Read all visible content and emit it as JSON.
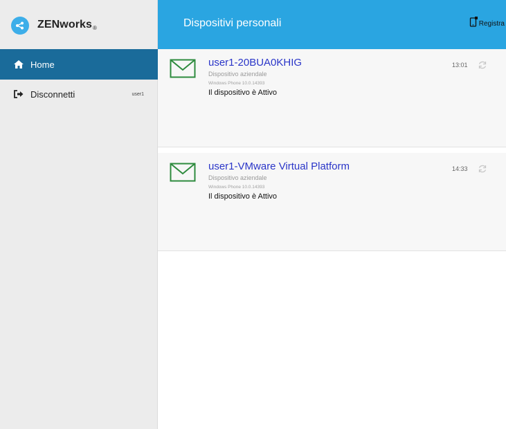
{
  "brand": {
    "name": "ZENworks",
    "trademark": "®",
    "logo_icon": "zenworks-logo-icon",
    "logo_color": "#3daee9"
  },
  "sidebar": {
    "items": [
      {
        "label": "Home",
        "icon": "home-icon",
        "active": true
      },
      {
        "label": "Disconnetti",
        "icon": "sign-out-icon",
        "user": "user1"
      }
    ],
    "active_color": "#1a6b9a"
  },
  "header": {
    "title": "Dispositivi personali",
    "register_label": "Registra",
    "register_icon": "device-register-icon",
    "color": "#2aa5e1"
  },
  "devices": [
    {
      "name": "user1-20BUA0KHIG",
      "type": "Dispositivo aziendale",
      "os": "Windows Phone 10.0.14393",
      "status": "Il dispositivo è Attivo",
      "time": "13:01",
      "icon": "mail-icon"
    },
    {
      "name": "user1-VMware Virtual Platform",
      "type": "Dispositivo aziendale",
      "os": "Windows Phone 10.0.14393",
      "status": "Il dispositivo è Attivo",
      "time": "14:33",
      "icon": "mail-icon"
    }
  ],
  "colors": {
    "device_title": "#2a35c8",
    "mail_icon": "#2e8b3e"
  }
}
